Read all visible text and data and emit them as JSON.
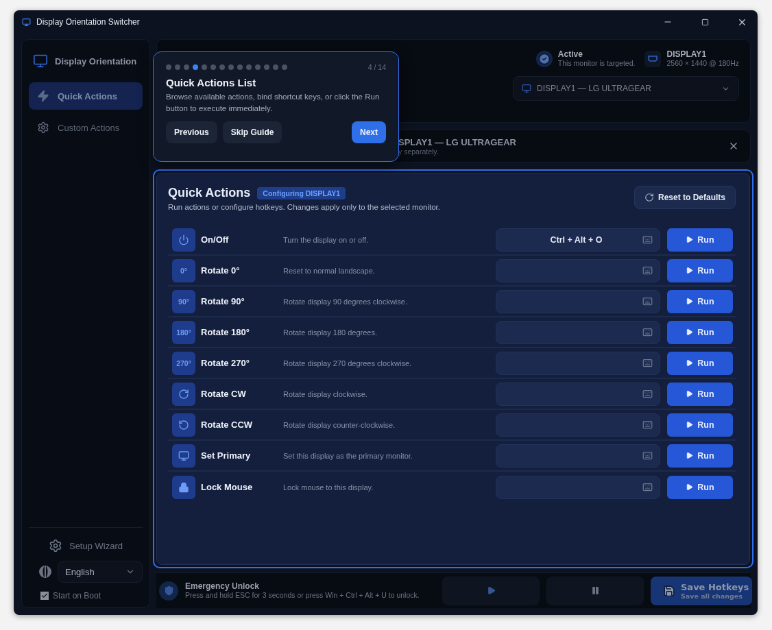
{
  "window": {
    "title": "Display Orientation Switcher"
  },
  "sidebar": {
    "title": "Display Orientation",
    "items": [
      {
        "label": "Quick Actions",
        "kind": "bolt",
        "selected": true
      },
      {
        "label": "Custom Actions",
        "kind": "gear",
        "selected": false
      }
    ],
    "setup": "Setup Wizard",
    "language": "English",
    "start_on_boot": {
      "label": "Start on Boot",
      "checked": true
    }
  },
  "status": {
    "state": "Active",
    "state_note": "This monitor is targeted.",
    "display": "DISPLAY1",
    "mode": "2560 × 1440 @ 180Hz",
    "selector": "DISPLAY1 — LG ULTRAGEAR"
  },
  "notice": {
    "title": "SPLAY1 — LG ULTRAGEAR",
    "text": "y separately."
  },
  "tour": {
    "steps": [
      {
        "selected": false
      },
      {
        "selected": false
      },
      {
        "selected": false
      },
      {
        "selected": true
      },
      {
        "selected": false
      },
      {
        "selected": false
      },
      {
        "selected": false
      },
      {
        "selected": false
      },
      {
        "selected": false
      },
      {
        "selected": false
      },
      {
        "selected": false
      },
      {
        "selected": false
      },
      {
        "selected": false
      },
      {
        "selected": false
      }
    ],
    "counter": "4 / 14",
    "title": "Quick Actions List",
    "text": "Browse available actions, bind shortcut keys, or click the Run button to execute immediately.",
    "buttons": [
      {
        "label": "Previous",
        "kind": "secondary"
      },
      {
        "label": "Skip Guide",
        "kind": "secondary"
      },
      {
        "label": "Next",
        "kind": "primary"
      }
    ]
  },
  "panel": {
    "title": "Quick Actions",
    "badge": "Configuring DISPLAY1",
    "subtitle": "Run actions or configure hotkeys. Changes apply only to the selected monitor.",
    "reset": "Reset to Defaults",
    "actions": [
      {
        "kind": "power",
        "name": "On/Off",
        "description": "Turn the display on or off.",
        "hotkey": "Ctrl + Alt + O",
        "run": "Run"
      },
      {
        "kind": "degrees",
        "badge": "0°",
        "name": "Rotate 0°",
        "description": "Reset to normal landscape.",
        "run": "Run"
      },
      {
        "kind": "degrees",
        "badge": "90°",
        "name": "Rotate 90°",
        "description": "Rotate display 90 degrees clockwise.",
        "run": "Run"
      },
      {
        "kind": "degrees",
        "badge": "180°",
        "name": "Rotate 180°",
        "description": "Rotate display 180 degrees.",
        "run": "Run"
      },
      {
        "kind": "degrees",
        "badge": "270°",
        "name": "Rotate 270°",
        "description": "Rotate display 270 degrees clockwise.",
        "run": "Run"
      },
      {
        "kind": "cw",
        "name": "Rotate CW",
        "description": "Rotate display clockwise.",
        "run": "Run"
      },
      {
        "kind": "ccw",
        "name": "Rotate CCW",
        "description": "Rotate display counter-clockwise.",
        "run": "Run"
      },
      {
        "kind": "monitor",
        "name": "Set Primary",
        "description": "Set this display as the primary monitor.",
        "run": "Run"
      },
      {
        "kind": "lock",
        "name": "Lock Mouse",
        "description": "Lock mouse to this display.",
        "run": "Run"
      }
    ]
  },
  "footer": {
    "title": "Emergency Unlock",
    "text": "Press and hold ESC for 3 seconds or press Win + Ctrl + Alt + U to unlock.",
    "save": "Save Hotkeys",
    "save_note": "Save all changes"
  }
}
